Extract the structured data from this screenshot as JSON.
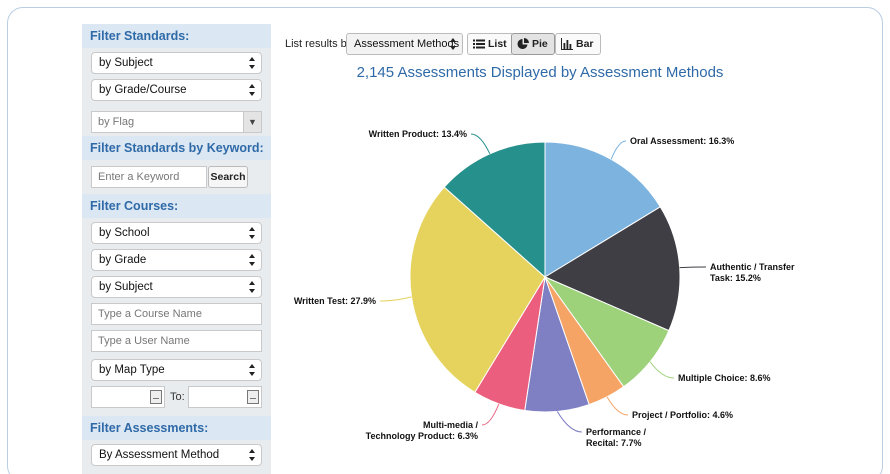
{
  "sidebar": {
    "filter_standards": {
      "title": "Filter Standards:",
      "subject": "by Subject",
      "grade_course": "by Grade/Course",
      "flag": "by Flag"
    },
    "filter_keyword": {
      "title": "Filter Standards by Keyword:",
      "placeholder": "Enter a Keyword",
      "search_label": "Search"
    },
    "filter_courses": {
      "title": "Filter Courses:",
      "school": "by School",
      "grade": "by Grade",
      "subject": "by Subject",
      "course_placeholder": "Type a Course Name",
      "user_placeholder": "Type a User Name",
      "map_type": "by Map Type",
      "to_label": "To:"
    },
    "filter_assessments": {
      "title": "Filter Assessments:",
      "method": "By Assessment Method"
    }
  },
  "toolbar": {
    "list_results_label": "List results by:",
    "method_value": "Assessment Methods",
    "list_label": "List",
    "pie_label": "Pie",
    "bar_label": "Bar",
    "active_view": "pie"
  },
  "chart_data": {
    "type": "pie",
    "title": "2,145 Assessments Displayed by Assessment Methods",
    "slices": [
      {
        "label": "Oral Assessment: 16.3%",
        "value": 16.3,
        "color": "#7cb3df"
      },
      {
        "label": "Authentic / Transfer Task: 15.2%",
        "lines": [
          "Authentic / Transfer",
          "Task: 15.2%"
        ],
        "value": 15.2,
        "color": "#3e3e44"
      },
      {
        "label": "Multiple Choice: 8.6%",
        "value": 8.6,
        "color": "#9dd27b"
      },
      {
        "label": "Project / Portfolio: 4.6%",
        "value": 4.6,
        "color": "#f6a465"
      },
      {
        "label": "Performance / Recital: 7.7%",
        "lines": [
          "Performance /",
          "Recital: 7.7%"
        ],
        "value": 7.7,
        "color": "#7f7fc4"
      },
      {
        "label": "Multi-media / Technology Product: 6.3%",
        "lines": [
          "Multi-media /",
          "Technology Product: 6.3%"
        ],
        "value": 6.3,
        "color": "#ec5e7e"
      },
      {
        "label": "Written Test: 27.9%",
        "value": 27.9,
        "color": "#e5d35e"
      },
      {
        "label": "Written Product: 13.4%",
        "value": 13.4,
        "color": "#25908c"
      }
    ]
  }
}
